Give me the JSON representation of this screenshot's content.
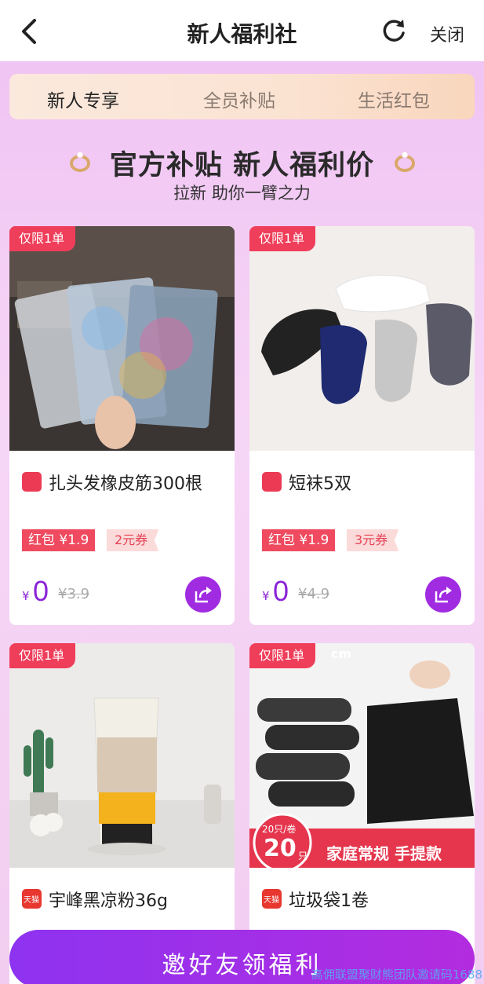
{
  "header": {
    "title": "新人福利社",
    "close_label": "关闭"
  },
  "tabs": [
    {
      "label": "新人专享",
      "active": true
    },
    {
      "label": "全员补贴",
      "active": false
    },
    {
      "label": "生活红包",
      "active": false
    }
  ],
  "banner": {
    "title": "官方补贴 新人福利价",
    "subtitle": "拉新 助你一臂之力"
  },
  "products": [
    {
      "badge": "仅限1单",
      "name": "扎头发橡皮筋300根",
      "hongbao": "红包 ¥1.9",
      "coupon": "2元券",
      "currency": "¥",
      "price": "0",
      "original_price": "¥3.9"
    },
    {
      "badge": "仅限1单",
      "name": "短袜5双",
      "hongbao": "红包 ¥1.9",
      "coupon": "3元券",
      "currency": "¥",
      "price": "0",
      "original_price": "¥4.9"
    },
    {
      "badge": "仅限1单",
      "name": "宇峰黑凉粉36g",
      "store_badge": "天猫"
    },
    {
      "badge": "仅限1单",
      "name": "垃圾袋1卷",
      "store_badge": "天猫",
      "image_text": {
        "corner": "cm",
        "pack": "20只/卷",
        "count": "20",
        "count_unit": "只",
        "ribbon": "家庭常规 手提款"
      }
    }
  ],
  "cta": {
    "label": "邀好友领福利"
  },
  "watermark": "高佣联盟聚财熊团队邀请码1688",
  "colors": {
    "accent": "#8a24d9",
    "badge": "#ef3e5a",
    "background": "#f3cdf3"
  }
}
